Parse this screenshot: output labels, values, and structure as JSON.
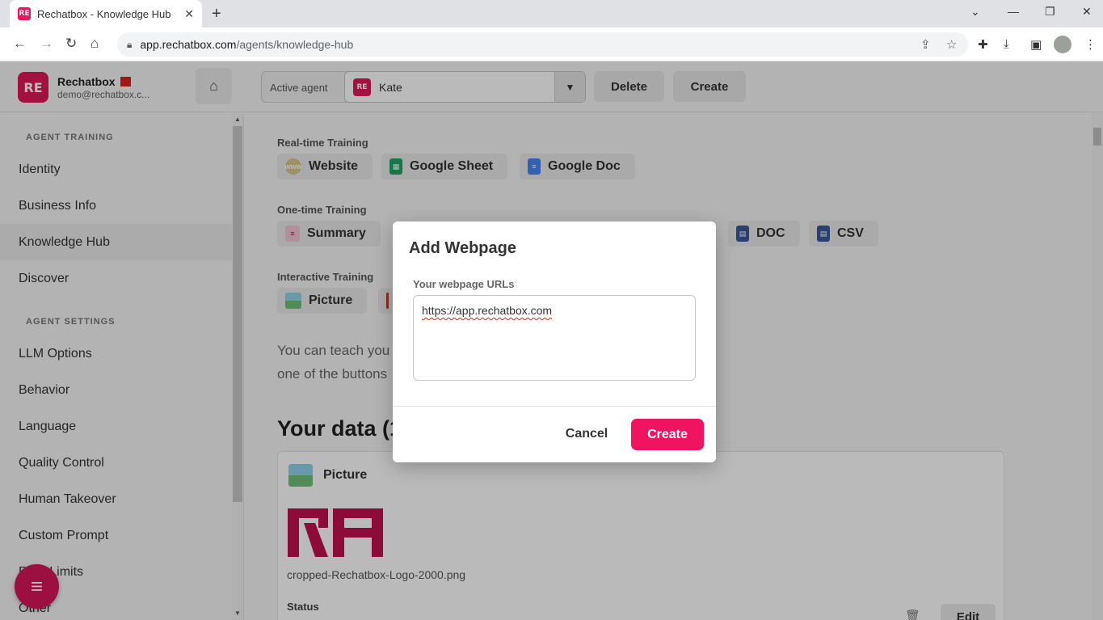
{
  "browser": {
    "tab_title": "Rechatbox - Knowledge Hub",
    "url_host": "app.rechatbox.com",
    "url_path": "/agents/knowledge-hub"
  },
  "header": {
    "brand_name": "Rechatbox",
    "brand_email": "demo@rechatbox.c...",
    "active_agent_label": "Active agent",
    "active_agent_value": "Kate",
    "delete_label": "Delete",
    "create_label": "Create"
  },
  "sidebar": {
    "training_heading": "AGENT TRAINING",
    "training_items": [
      "Identity",
      "Business Info",
      "Knowledge Hub",
      "Discover"
    ],
    "settings_heading": "AGENT SETTINGS",
    "settings_items": [
      "LLM Options",
      "Behavior",
      "Language",
      "Quality Control",
      "Human Takeover",
      "Custom Prompt",
      "Rate Limits",
      "Other"
    ]
  },
  "main": {
    "realtime_label": "Real-time Training",
    "realtime_buttons": [
      "Website",
      "Google Sheet",
      "Google Doc"
    ],
    "onetime_label": "One-time Training",
    "onetime_buttons": [
      "Summary",
      "DOC",
      "CSV"
    ],
    "interactive_label": "Interactive Training",
    "interactive_buttons": [
      "Picture"
    ],
    "body_line1": "You can teach you",
    "body_line2": "one of the buttons",
    "your_data_title": "Your data (1",
    "card": {
      "title": "Picture",
      "file_name": "cropped-Rechatbox-Logo-2000.png",
      "status_label": "Status",
      "edit_label": "Edit"
    }
  },
  "modal": {
    "title": "Add Webpage",
    "field_label": "Your webpage URLs",
    "field_value": "https://app.rechatbox.com",
    "cancel_label": "Cancel",
    "create_label": "Create"
  },
  "colors": {
    "brand": "#e0185a",
    "primary_button": "#f01460"
  }
}
